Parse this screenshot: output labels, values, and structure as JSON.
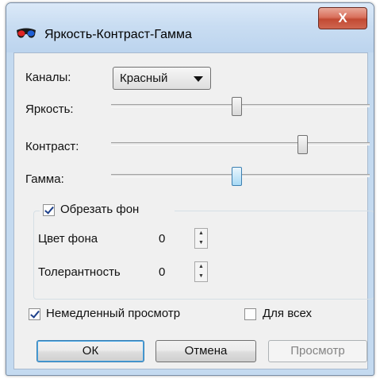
{
  "window": {
    "title": "Яркость-Контраст-Гамма",
    "close_symbol": "X"
  },
  "channels": {
    "label": "Каналы:",
    "selected": "Красный"
  },
  "sliders": [
    {
      "label": "Яркость:",
      "value_fraction": 0.49
    },
    {
      "label": "Контраст:",
      "value_fraction": 0.74
    },
    {
      "label": "Гамма:",
      "value_fraction": 0.49
    }
  ],
  "crop_background": {
    "label": "Обрезать фон",
    "checked": true,
    "color_label": "Цвет фона",
    "color_value": "0",
    "tolerance_label": "Толерантность",
    "tolerance_value": "0"
  },
  "immediate_preview": {
    "label": "Немедленный просмотр",
    "checked": true
  },
  "for_all": {
    "label": "Для всех",
    "checked": false
  },
  "buttons": {
    "ok": "ОК",
    "cancel": "Отмена",
    "preview": "Просмотр"
  },
  "icons": {
    "title": "3d-glasses-icon",
    "close": "close-icon",
    "dropdown": "chevron-down-icon"
  },
  "colors": {
    "titlebar": "#c4daf0",
    "close_button": "#c24a33",
    "dialog_background": "#f0f0f0",
    "focus_blue": "#3c7fb1"
  }
}
